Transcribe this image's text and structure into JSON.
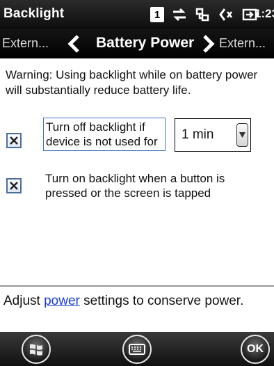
{
  "status": {
    "title": "Backlight",
    "badge": "1",
    "time": "1:23",
    "icons": [
      "data-sync-icon",
      "connection-icon",
      "speaker-muted-icon",
      "battery-charging-icon"
    ]
  },
  "pivot": {
    "prev": "Extern...",
    "current": "Battery Power",
    "next": "Extern..."
  },
  "content": {
    "warning": "Warning: Using backlight while on battery power will substantially reduce battery life.",
    "option1": {
      "label": "Turn off backlight if device is not used for",
      "checked": true
    },
    "timeout": {
      "selected": "1 min"
    },
    "option2": {
      "label": "Turn on backlight when a button is pressed or the screen is tapped",
      "checked": true
    }
  },
  "footer": {
    "prefix": "Adjust ",
    "link": "power",
    "suffix": " settings to conserve power."
  },
  "softkeys": {
    "start_icon": "windows-start-icon",
    "keyboard_icon": "keyboard-icon",
    "ok": "OK"
  },
  "colors": {
    "link": "#1a3fd6",
    "focus_border": "#3f6fc4",
    "checkbox_border": "#4b6f9c"
  }
}
